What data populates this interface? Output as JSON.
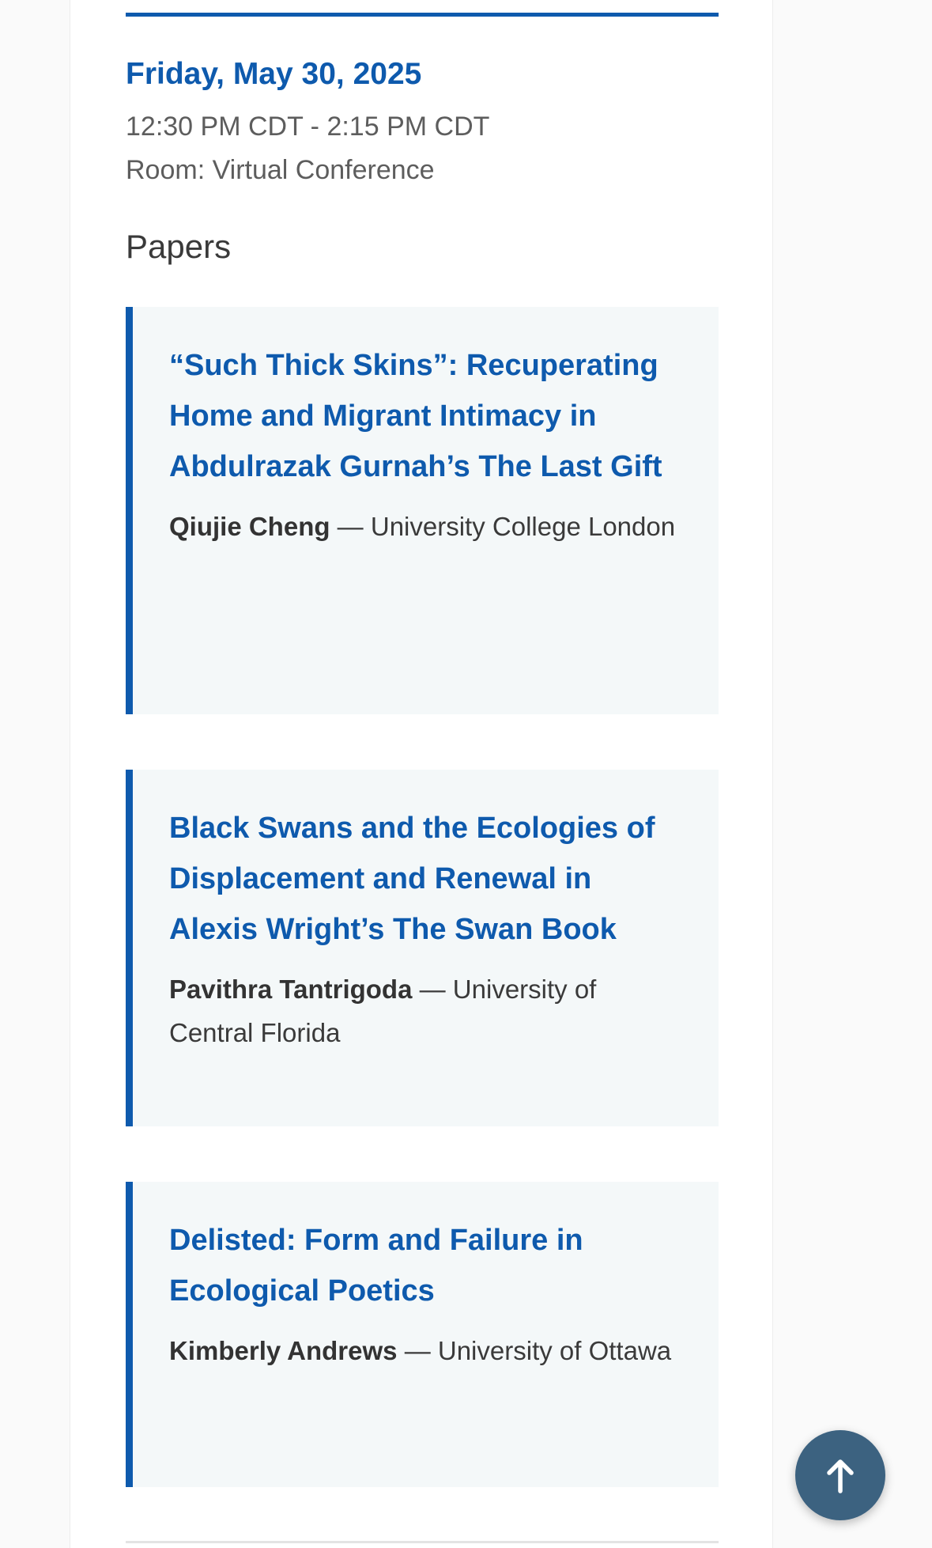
{
  "session": {
    "date": "Friday, May 30, 2025",
    "time": "12:30 PM CDT - 2:15 PM CDT",
    "room": "Room: Virtual Conference"
  },
  "papers_heading": "Papers",
  "papers": [
    {
      "title": "“Such Thick Skins”: Recuperating Home and Migrant Intimacy in Abdulrazak Gurnah’s The Last Gift",
      "author": "Qiujie Cheng",
      "separator": " — ",
      "affiliation": "University College London"
    },
    {
      "title": "Black Swans and the Ecologies of Displacement and Renewal in Alexis Wright’s The Swan Book",
      "author": "Pavithra Tantrigoda",
      "separator": " — ",
      "affiliation": "University of Central Florida"
    },
    {
      "title": "Delisted: Form and Failure in Ecological Poetics",
      "author": "Kimberly Andrews",
      "separator": " — ",
      "affiliation": "University of Ottawa"
    }
  ],
  "back_to_top": {
    "icon": "arrow-up-icon"
  },
  "colors": {
    "accent": "#0e5aad",
    "card_background": "#f4f8f9",
    "back_to_top_button": "#3c6280"
  }
}
